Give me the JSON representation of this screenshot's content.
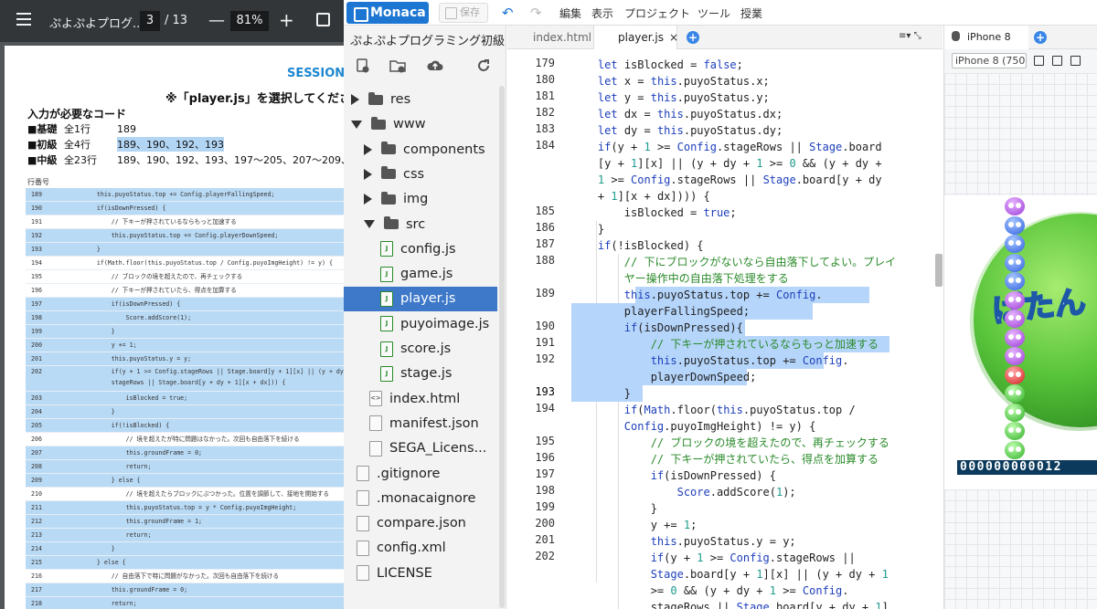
{
  "pdf": {
    "title": "ぷよぷよプログ...",
    "page": "3",
    "total": "/ 13",
    "zoom": "81%",
    "minus": "—",
    "plus": "+",
    "session": "SESSION",
    "instruction": "※「player.js」を選択してください。",
    "need_code": "入力が必要なコード",
    "levels": [
      {
        "label": "■基礎",
        "count": "全1行",
        "lines": "189"
      },
      {
        "label": "■初級",
        "count": "全4行",
        "lines": "189、190、192、193"
      },
      {
        "label": "■中級",
        "count": "全23行",
        "lines": "189、190、192、193、197〜205、207〜209、..."
      }
    ],
    "line_no_header": "行番号",
    "rows": [
      {
        "n": "189",
        "c": "    this.puyoStatus.top += Config.playerFallingSpeed;",
        "hl": true
      },
      {
        "n": "190",
        "c": "    if(isDownPressed) {",
        "hl": true
      },
      {
        "n": "191",
        "c": "        // 下キーが押されているならもっと加速する",
        "hl": false
      },
      {
        "n": "192",
        "c": "        this.puyoStatus.top += Config.playerDownSpeed;",
        "hl": true
      },
      {
        "n": "193",
        "c": "    }",
        "hl": true
      },
      {
        "n": "194",
        "c": "    if(Math.floor(this.puyoStatus.top / Config.puyoImgHeight) != y) {",
        "hl": false
      },
      {
        "n": "195",
        "c": "        // ブロックの境を超えたので、再チェックする",
        "hl": false
      },
      {
        "n": "196",
        "c": "        // 下キーが押されていたら、得点を加算する",
        "hl": false
      },
      {
        "n": "197",
        "c": "        if(isDownPressed) {",
        "hl": true
      },
      {
        "n": "198",
        "c": "            Score.addScore(1);",
        "hl": true
      },
      {
        "n": "199",
        "c": "        }",
        "hl": true
      },
      {
        "n": "200",
        "c": "        y += 1;",
        "hl": true
      },
      {
        "n": "201",
        "c": "        this.puyoStatus.y = y;",
        "hl": true
      },
      {
        "n": "202",
        "c": "        if(y + 1 >= Config.stageRows || Stage.board[y + 1][x] || (y + dy\n        stageRows || Stage.board[y + dy + 1][x + dx])) {",
        "hl": true,
        "tall": true
      },
      {
        "n": "203",
        "c": "            isBlocked = true;",
        "hl": true
      },
      {
        "n": "204",
        "c": "        }",
        "hl": true
      },
      {
        "n": "205",
        "c": "        if(!isBlocked) {",
        "hl": true
      },
      {
        "n": "206",
        "c": "            // 境を超えたが特に問題はなかった。次回も自由落下を続ける",
        "hl": false
      },
      {
        "n": "207",
        "c": "            this.groundFrame = 0;",
        "hl": true
      },
      {
        "n": "208",
        "c": "            return;",
        "hl": true
      },
      {
        "n": "209",
        "c": "        } else {",
        "hl": true
      },
      {
        "n": "210",
        "c": "            // 境を超えたらブロックにぶつかった。位置を調節して、接地を開始する",
        "hl": false
      },
      {
        "n": "211",
        "c": "            this.puyoStatus.top = y * Config.puyoImgHeight;",
        "hl": true
      },
      {
        "n": "212",
        "c": "            this.groundFrame = 1;",
        "hl": true
      },
      {
        "n": "213",
        "c": "            return;",
        "hl": true
      },
      {
        "n": "214",
        "c": "        }",
        "hl": true
      },
      {
        "n": "215",
        "c": "    } else {",
        "hl": true
      },
      {
        "n": "216",
        "c": "        // 自由落下で特に問題がなかった。次回も自由落下を続ける",
        "hl": false
      },
      {
        "n": "217",
        "c": "        this.groundFrame = 0;",
        "hl": true
      },
      {
        "n": "218",
        "c": "        return;",
        "hl": true
      }
    ]
  },
  "monaca": {
    "logo": "Monaca",
    "save": "保存",
    "undo": "↶",
    "redo": "↷",
    "menus": [
      "編集",
      "表示",
      "プロジェクト",
      "ツール",
      "授業"
    ],
    "project": "ぷよぷよプログラミング初級",
    "tree": [
      {
        "label": "res",
        "type": "folder",
        "open": false
      },
      {
        "label": "www",
        "type": "folder",
        "open": true
      },
      {
        "label": "components",
        "type": "folder",
        "open": false
      },
      {
        "label": "css",
        "type": "folder",
        "open": false
      },
      {
        "label": "img",
        "type": "folder",
        "open": false
      },
      {
        "label": "src",
        "type": "folder",
        "open": true
      },
      {
        "label": "config.js",
        "type": "js"
      },
      {
        "label": "game.js",
        "type": "js"
      },
      {
        "label": "player.js",
        "type": "js",
        "selected": true
      },
      {
        "label": "puyoimage.js",
        "type": "js"
      },
      {
        "label": "score.js",
        "type": "js"
      },
      {
        "label": "stage.js",
        "type": "js"
      },
      {
        "label": "index.html",
        "type": "html"
      },
      {
        "label": "manifest.json",
        "type": "json"
      },
      {
        "label": "SEGA_Licens...",
        "type": "file"
      },
      {
        "label": ".gitignore",
        "type": "file"
      },
      {
        "label": ".monacaignore",
        "type": "file"
      },
      {
        "label": "compare.json",
        "type": "json"
      },
      {
        "label": "config.xml",
        "type": "file"
      },
      {
        "label": "LICENSE",
        "type": "file"
      }
    ],
    "tabs": [
      {
        "label": "index.html",
        "active": false
      },
      {
        "label": "player.js",
        "active": true,
        "close": "×"
      }
    ],
    "tab_plus": "+",
    "tab_tools": "≡▾ ⤡",
    "gutter": [
      {
        "n": "179",
        "row": 0
      },
      {
        "n": "180",
        "row": 1
      },
      {
        "n": "181",
        "row": 2
      },
      {
        "n": "182",
        "row": 3
      },
      {
        "n": "183",
        "row": 4
      },
      {
        "n": "184",
        "row": 5
      },
      {
        "n": "185",
        "row": 9
      },
      {
        "n": "186",
        "row": 10
      },
      {
        "n": "187",
        "row": 11
      },
      {
        "n": "188",
        "row": 12
      },
      {
        "n": "189",
        "row": 14
      },
      {
        "n": "190",
        "row": 16
      },
      {
        "n": "191",
        "row": 17
      },
      {
        "n": "192",
        "row": 18
      },
      {
        "n": "193",
        "row": 20
      },
      {
        "n": "194",
        "row": 21
      },
      {
        "n": "195",
        "row": 23
      },
      {
        "n": "196",
        "row": 24
      },
      {
        "n": "197",
        "row": 25
      },
      {
        "n": "198",
        "row": 26
      },
      {
        "n": "199",
        "row": 27
      },
      {
        "n": "200",
        "row": 28
      },
      {
        "n": "201",
        "row": 29
      },
      {
        "n": "202",
        "row": 30
      }
    ],
    "code": [
      [
        {
          "t": "    "
        },
        {
          "t": "let",
          "k": "kw"
        },
        {
          "t": " isBlocked = "
        },
        {
          "t": "false",
          "k": "kw"
        },
        {
          "t": ";"
        }
      ],
      [
        {
          "t": "    "
        },
        {
          "t": "let",
          "k": "kw"
        },
        {
          "t": " x = "
        },
        {
          "t": "this",
          "k": "kw"
        },
        {
          "t": ".puyoStatus.x;"
        }
      ],
      [
        {
          "t": "    "
        },
        {
          "t": "let",
          "k": "kw"
        },
        {
          "t": " y = "
        },
        {
          "t": "this",
          "k": "kw"
        },
        {
          "t": ".puyoStatus.y;"
        }
      ],
      [
        {
          "t": "    "
        },
        {
          "t": "let",
          "k": "kw"
        },
        {
          "t": " dx = "
        },
        {
          "t": "this",
          "k": "kw"
        },
        {
          "t": ".puyoStatus.dx;"
        }
      ],
      [
        {
          "t": "    "
        },
        {
          "t": "let",
          "k": "kw"
        },
        {
          "t": " dy = "
        },
        {
          "t": "this",
          "k": "kw"
        },
        {
          "t": ".puyoStatus.dy;"
        }
      ],
      [
        {
          "t": "    "
        },
        {
          "t": "if",
          "k": "kw"
        },
        {
          "t": "(y + "
        },
        {
          "t": "1",
          "k": "num"
        },
        {
          "t": " >= "
        },
        {
          "t": "Config",
          "k": "kw"
        },
        {
          "t": ".stageRows || "
        },
        {
          "t": "Stage",
          "k": "kw"
        },
        {
          "t": ".board"
        }
      ],
      [
        {
          "t": "    [y + "
        },
        {
          "t": "1",
          "k": "num"
        },
        {
          "t": "][x] || (y + dy + "
        },
        {
          "t": "1",
          "k": "num"
        },
        {
          "t": " >= "
        },
        {
          "t": "0",
          "k": "num"
        },
        {
          "t": " && (y + dy +"
        }
      ],
      [
        {
          "t": "    "
        },
        {
          "t": "1",
          "k": "num"
        },
        {
          "t": " >= "
        },
        {
          "t": "Config",
          "k": "kw"
        },
        {
          "t": ".stageRows || "
        },
        {
          "t": "Stage",
          "k": "kw"
        },
        {
          "t": ".board[y + dy"
        }
      ],
      [
        {
          "t": "    + "
        },
        {
          "t": "1",
          "k": "num"
        },
        {
          "t": "][x + dx]))) {"
        }
      ],
      [
        {
          "t": "        isBlocked = "
        },
        {
          "t": "true",
          "k": "kw"
        },
        {
          "t": ";"
        }
      ],
      [
        {
          "t": "    }"
        }
      ],
      [
        {
          "t": "    "
        },
        {
          "t": "if",
          "k": "kw"
        },
        {
          "t": "(!isBlocked) {"
        }
      ],
      [
        {
          "t": "        "
        },
        {
          "t": "// 下にブロックがないなら自由落下してよい。プレイ",
          "k": "cm"
        }
      ],
      [
        {
          "t": "        "
        },
        {
          "t": "ヤー操作中の自由落下処理をする",
          "k": "cm"
        }
      ],
      [
        {
          "t": "        "
        },
        {
          "t": "this",
          "k": "kw"
        },
        {
          "t": ".puyoStatus.top += "
        },
        {
          "t": "Config",
          "k": "kw"
        },
        {
          "t": "."
        }
      ],
      [
        {
          "t": "        playerFallingSpeed;"
        }
      ],
      [
        {
          "t": "        "
        },
        {
          "t": "if",
          "k": "kw"
        },
        {
          "t": "(isDownPressed){"
        }
      ],
      [
        {
          "t": "            "
        },
        {
          "t": "// 下キーが押されているならもっと加速する",
          "k": "cm"
        }
      ],
      [
        {
          "t": "            "
        },
        {
          "t": "this",
          "k": "kw"
        },
        {
          "t": ".puyoStatus.top += "
        },
        {
          "t": "Config",
          "k": "kw"
        },
        {
          "t": "."
        }
      ],
      [
        {
          "t": "            playerDownSpeed;"
        }
      ],
      [
        {
          "t": "        }"
        }
      ],
      [
        {
          "t": "        "
        },
        {
          "t": "if",
          "k": "kw"
        },
        {
          "t": "("
        },
        {
          "t": "Math",
          "k": "kw"
        },
        {
          "t": ".floor("
        },
        {
          "t": "this",
          "k": "kw"
        },
        {
          "t": ".puyoStatus.top /"
        }
      ],
      [
        {
          "t": "        "
        },
        {
          "t": "Config",
          "k": "kw"
        },
        {
          "t": ".puyoImgHeight) != y) {"
        }
      ],
      [
        {
          "t": "            "
        },
        {
          "t": "// ブロックの境を超えたので、再チェックする",
          "k": "cm"
        }
      ],
      [
        {
          "t": "            "
        },
        {
          "t": "// 下キーが押されていたら、得点を加算する",
          "k": "cm"
        }
      ],
      [
        {
          "t": "            "
        },
        {
          "t": "if",
          "k": "kw"
        },
        {
          "t": "(isDownPressed) {"
        }
      ],
      [
        {
          "t": "                "
        },
        {
          "t": "Score",
          "k": "kw"
        },
        {
          "t": ".addScore("
        },
        {
          "t": "1",
          "k": "num"
        },
        {
          "t": ");"
        }
      ],
      [
        {
          "t": "            }"
        }
      ],
      [
        {
          "t": "            y += "
        },
        {
          "t": "1",
          "k": "num"
        },
        {
          "t": ";"
        }
      ],
      [
        {
          "t": "            "
        },
        {
          "t": "this",
          "k": "kw"
        },
        {
          "t": ".puyoStatus.y = y;"
        }
      ],
      [
        {
          "t": "            "
        },
        {
          "t": "if",
          "k": "kw"
        },
        {
          "t": "(y + "
        },
        {
          "t": "1",
          "k": "num"
        },
        {
          "t": " >= "
        },
        {
          "t": "Config",
          "k": "kw"
        },
        {
          "t": ".stageRows ||"
        }
      ],
      [
        {
          "t": "            "
        },
        {
          "t": "Stage",
          "k": "kw"
        },
        {
          "t": ".board[y + "
        },
        {
          "t": "1",
          "k": "num"
        },
        {
          "t": "][x] || (y + dy + "
        },
        {
          "t": "1",
          "k": "num"
        }
      ],
      [
        {
          "t": "            >= "
        },
        {
          "t": "0",
          "k": "num"
        },
        {
          "t": " && (y + dy + "
        },
        {
          "t": "1",
          "k": "num"
        },
        {
          "t": " >= "
        },
        {
          "t": "Config",
          "k": "kw"
        },
        {
          "t": "."
        }
      ],
      [
        {
          "t": "            stageRows || "
        },
        {
          "t": "Stage",
          "k": "kw"
        },
        {
          "t": ".board[y + dy + "
        },
        {
          "t": "1",
          "k": "num"
        },
        {
          "t": "]"
        }
      ],
      [
        {
          "t": "            [x + dx])))) {"
        }
      ]
    ],
    "preview": {
      "tab": "iPhone 8",
      "plus": "+",
      "device": "iPhone 8 (750",
      "logo_text": "ぱたん きゅー",
      "score": "000000000012"
    }
  }
}
